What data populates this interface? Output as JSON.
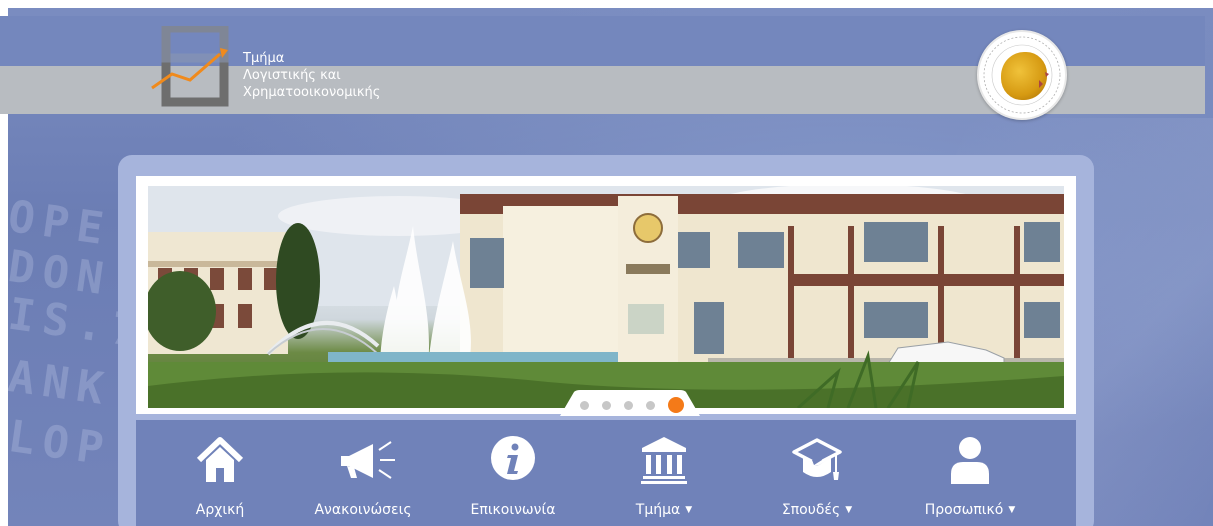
{
  "header": {
    "department_name_lines": [
      "Τμήμα",
      "Λογιστικής και",
      "Χρηματοοικονομικής"
    ],
    "logo": "department-logo-chart",
    "seal": "university-seal"
  },
  "slider": {
    "dot_count": 5,
    "active_index": 4
  },
  "nav": {
    "items": [
      {
        "label": "Αρχική",
        "icon": "home-icon",
        "has_dropdown": false
      },
      {
        "label": "Ανακοινώσεις",
        "icon": "megaphone-icon",
        "has_dropdown": false
      },
      {
        "label": "Επικοινωνία",
        "icon": "info-icon",
        "has_dropdown": false
      },
      {
        "label": "Τμήμα",
        "icon": "building-icon",
        "has_dropdown": true
      },
      {
        "label": "Σπουδές",
        "icon": "graduation-cap-icon",
        "has_dropdown": true
      },
      {
        "label": "Προσωπικό",
        "icon": "person-icon",
        "has_dropdown": true
      }
    ],
    "caret": "▼"
  },
  "colors": {
    "accent_active_dot": "#f47a18",
    "header_band": "#b8bcc1",
    "nav_bar": "#7082b9",
    "panel": "#a6b4dc"
  }
}
